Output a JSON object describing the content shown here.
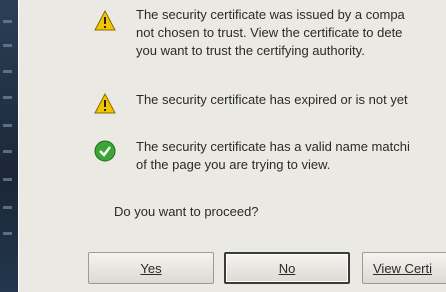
{
  "dialog": {
    "warnings": [
      {
        "icon": "warning-icon",
        "lines": [
          "The security certificate was issued by a compa",
          "not chosen to trust. View the certificate to dete",
          "you want to trust the certifying authority."
        ]
      },
      {
        "icon": "warning-icon",
        "lines": [
          "The security certificate has expired or is not yet"
        ]
      },
      {
        "icon": "check-icon",
        "lines": [
          "The security certificate has a valid name matchi",
          "of the page you are trying to view."
        ]
      }
    ],
    "question": "Do you want to proceed?",
    "buttons": {
      "yes": "Yes",
      "no": "No",
      "view_certificate": "View Certi"
    }
  },
  "colors": {
    "dialog_bg": "#ebe9e3",
    "warning_yellow": "#f2c500",
    "check_green": "#3aa635"
  }
}
